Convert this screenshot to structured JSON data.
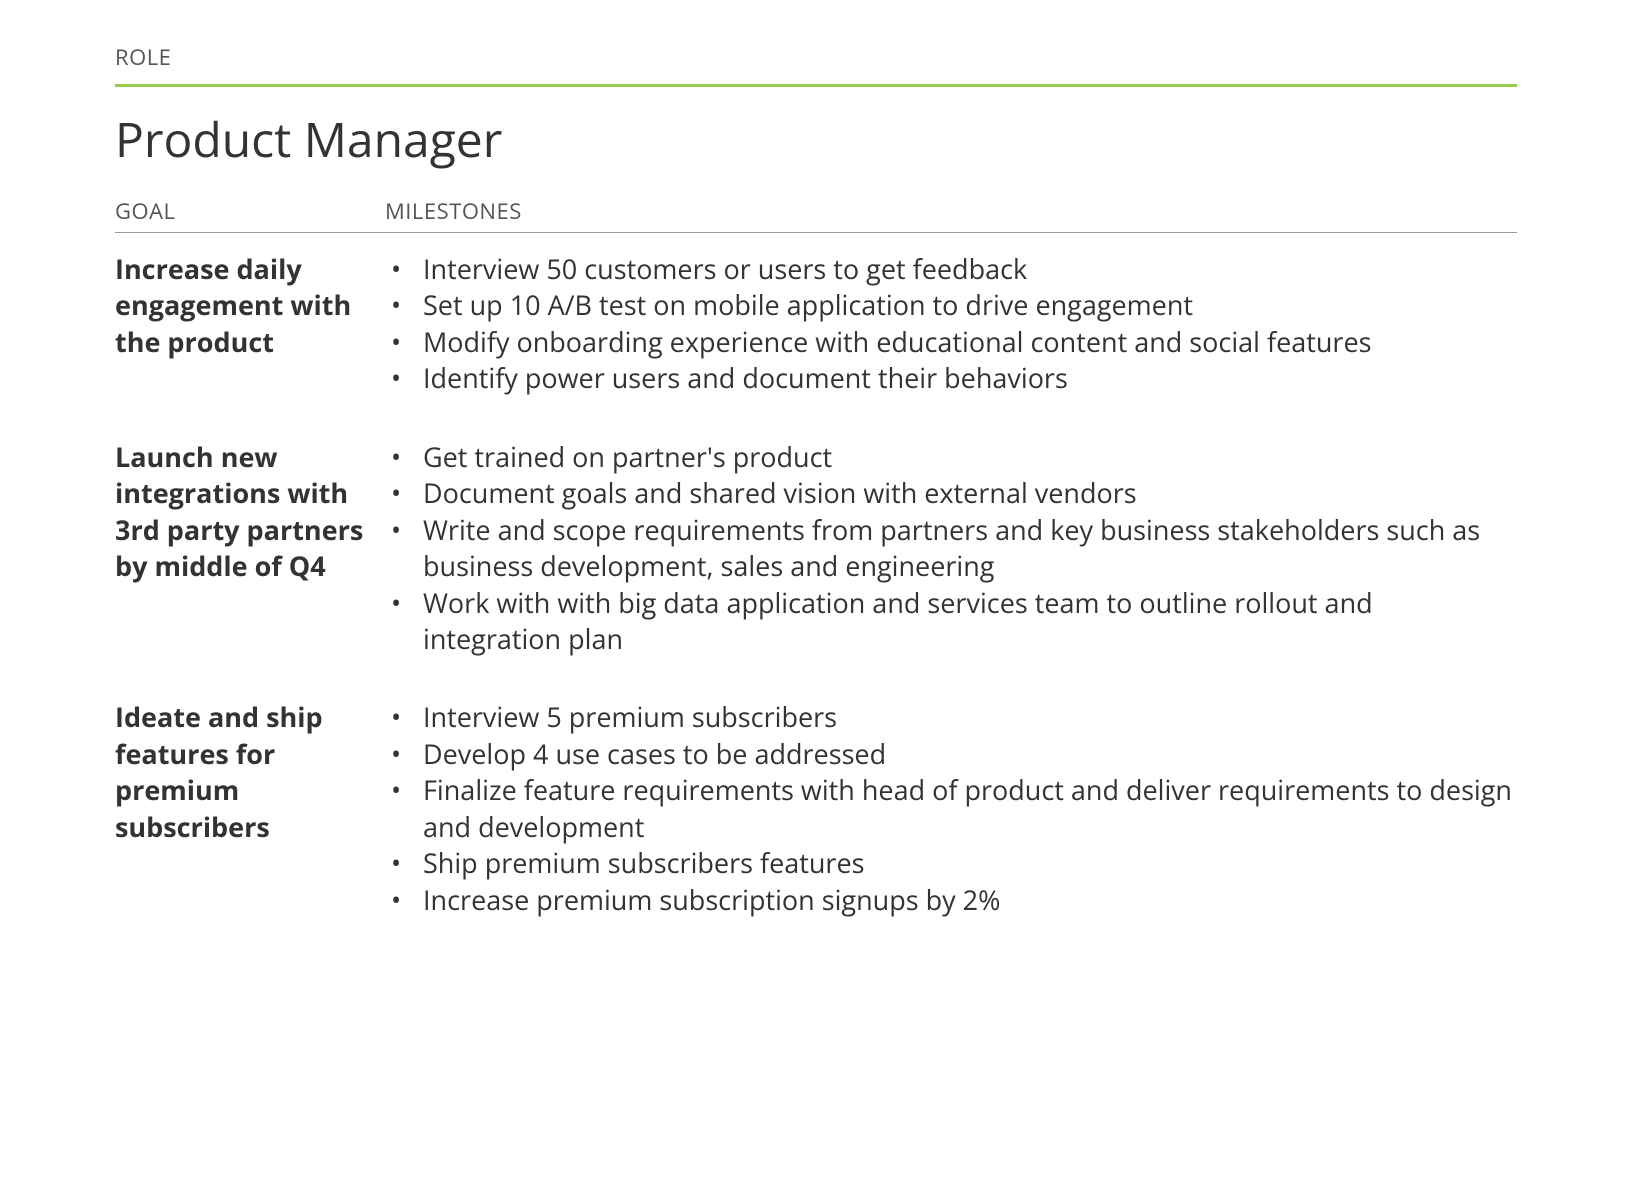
{
  "labels": {
    "role": "ROLE",
    "goal": "GOAL",
    "milestones": "MILESTONES"
  },
  "title": "Product Manager",
  "goals": [
    {
      "goal": "Increase daily engagement with the product",
      "milestones": [
        "Interview 50 customers or users to get feedback",
        "Set up 10 A/B test on mobile application to drive engagement",
        "Modify onboarding experience with educational content and social features",
        "Identify power users and document their behaviors"
      ]
    },
    {
      "goal": "Launch new integrations with 3rd party partners by middle of Q4",
      "milestones": [
        "Get trained on partner's product",
        "Document goals and shared vision with external vendors",
        "Write and scope requirements from partners and key business stakeholders such as business development, sales and engineering",
        "Work with with big data application and services team to outline rollout and integration plan"
      ]
    },
    {
      "goal": "Ideate and ship features for premium subscribers",
      "milestones": [
        "Interview 5 premium subscribers",
        "Develop 4 use cases to be addressed",
        "Finalize feature requirements with head of product and deliver requirements to design and development",
        "Ship premium subscribers features",
        "Increase premium subscription signups by 2%"
      ]
    }
  ]
}
